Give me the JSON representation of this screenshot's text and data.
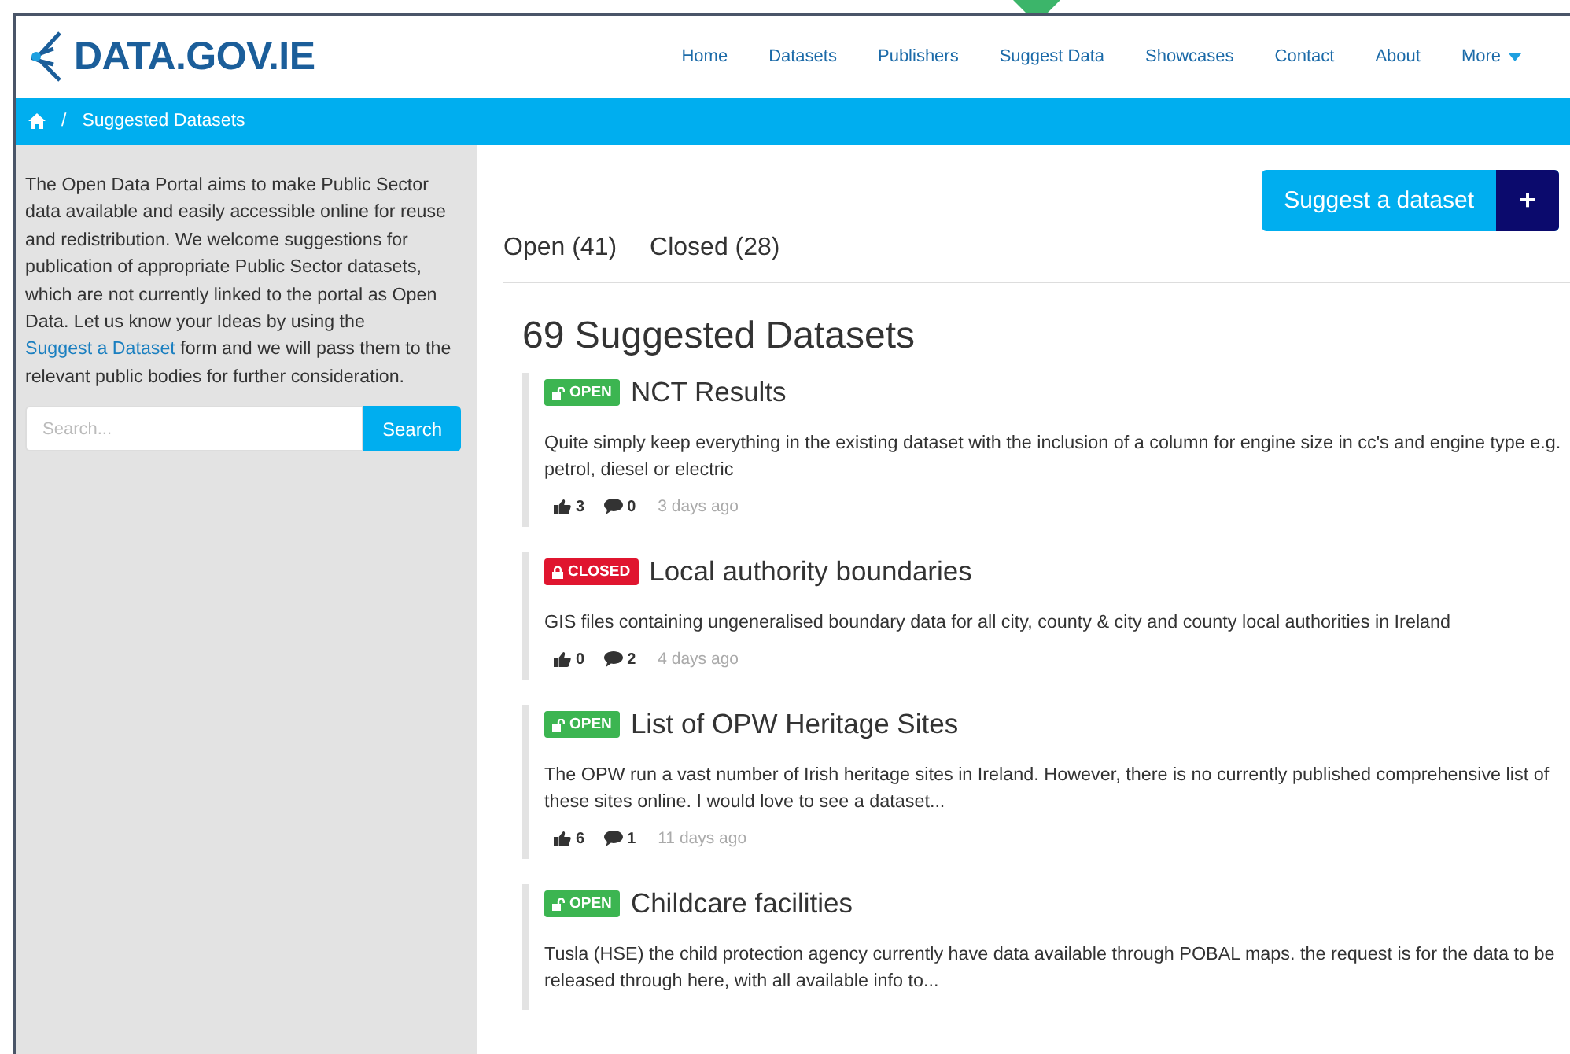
{
  "header": {
    "logo": "DATA.GOV.IE",
    "nav": [
      {
        "label": "Home",
        "has_menu": false
      },
      {
        "label": "Datasets",
        "has_menu": false
      },
      {
        "label": "Publishers",
        "has_menu": false
      },
      {
        "label": "Suggest Data",
        "has_menu": false
      },
      {
        "label": "Showcases",
        "has_menu": false
      },
      {
        "label": "Contact",
        "has_menu": false
      },
      {
        "label": "About",
        "has_menu": false
      },
      {
        "label": "More",
        "has_menu": true
      }
    ]
  },
  "breadcrumb": {
    "separator": "/",
    "current": "Suggested Datasets"
  },
  "sidebar": {
    "intro_before": "The Open Data Portal aims to make Public Sector data available and easily accessible online for reuse and redistribution. We welcome suggestions for publication of appropriate Public Sector datasets, which are not currently linked to the portal as Open Data. Let us know your Ideas by using the ",
    "intro_link": "Suggest a Dataset",
    "intro_after": " form and we will pass them to the relevant public bodies for further consideration.",
    "search": {
      "placeholder": "Search...",
      "button": "Search"
    }
  },
  "suggest_button": {
    "label": "Suggest a dataset",
    "icon": "+"
  },
  "filters": [
    {
      "label": "Open (41)",
      "selected": false
    },
    {
      "label": "Closed (28)",
      "selected": false
    }
  ],
  "heading": "69 Suggested Datasets",
  "items": [
    {
      "kind": "open",
      "badge": "OPEN",
      "title": "NCT Results",
      "description": "Quite simply keep everything in the existing dataset with the inclusion of a column for engine size in cc's and engine type e.g. petrol, diesel or electric",
      "likes": "3",
      "comments": "0",
      "age": "3 days ago"
    },
    {
      "kind": "closed",
      "badge": "CLOSED",
      "title": "Local authority boundaries",
      "description": "GIS files containing ungeneralised boundary data for all city, county & city and county local authorities in Ireland",
      "likes": "0",
      "comments": "2",
      "age": "4 days ago"
    },
    {
      "kind": "open",
      "badge": "OPEN",
      "title": "List of OPW Heritage Sites",
      "description": "The OPW run a vast number of Irish heritage sites in Ireland. However, there is no currently published comprehensive list of these sites online. I would love to see a dataset...",
      "likes": "6",
      "comments": "1",
      "age": "11 days ago"
    },
    {
      "kind": "open",
      "badge": "OPEN",
      "title": "Childcare facilities",
      "description": "Tusla (HSE) the child protection agency currently have data available through POBAL maps. the request is for the data to be released through here, with all available info to..."
    }
  ]
}
